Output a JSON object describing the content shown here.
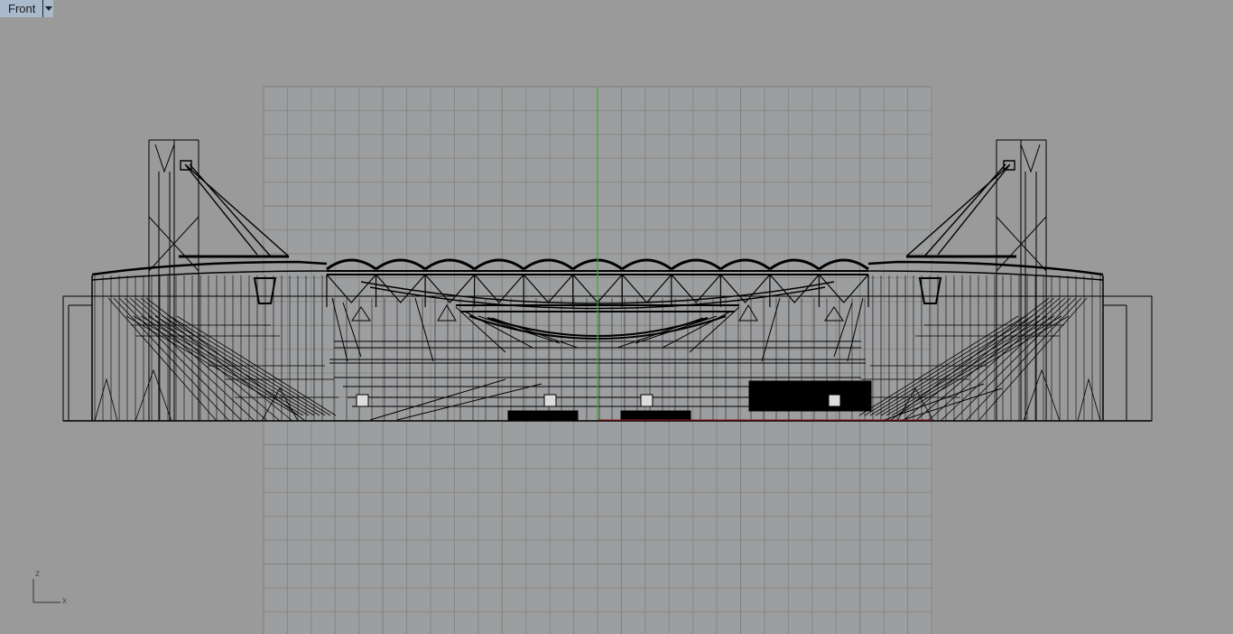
{
  "viewport": {
    "title": "Front",
    "view_mode": "wireframe",
    "axis_widget": {
      "vertical_label": "z",
      "horizontal_label": "x"
    }
  },
  "colors": {
    "background": "#9a9a9a",
    "grid_line": "#878787",
    "y_axis": "#2fae2f",
    "x_axis": "#a01818",
    "wireframe": "#000000",
    "tab": "#a9bacd"
  }
}
